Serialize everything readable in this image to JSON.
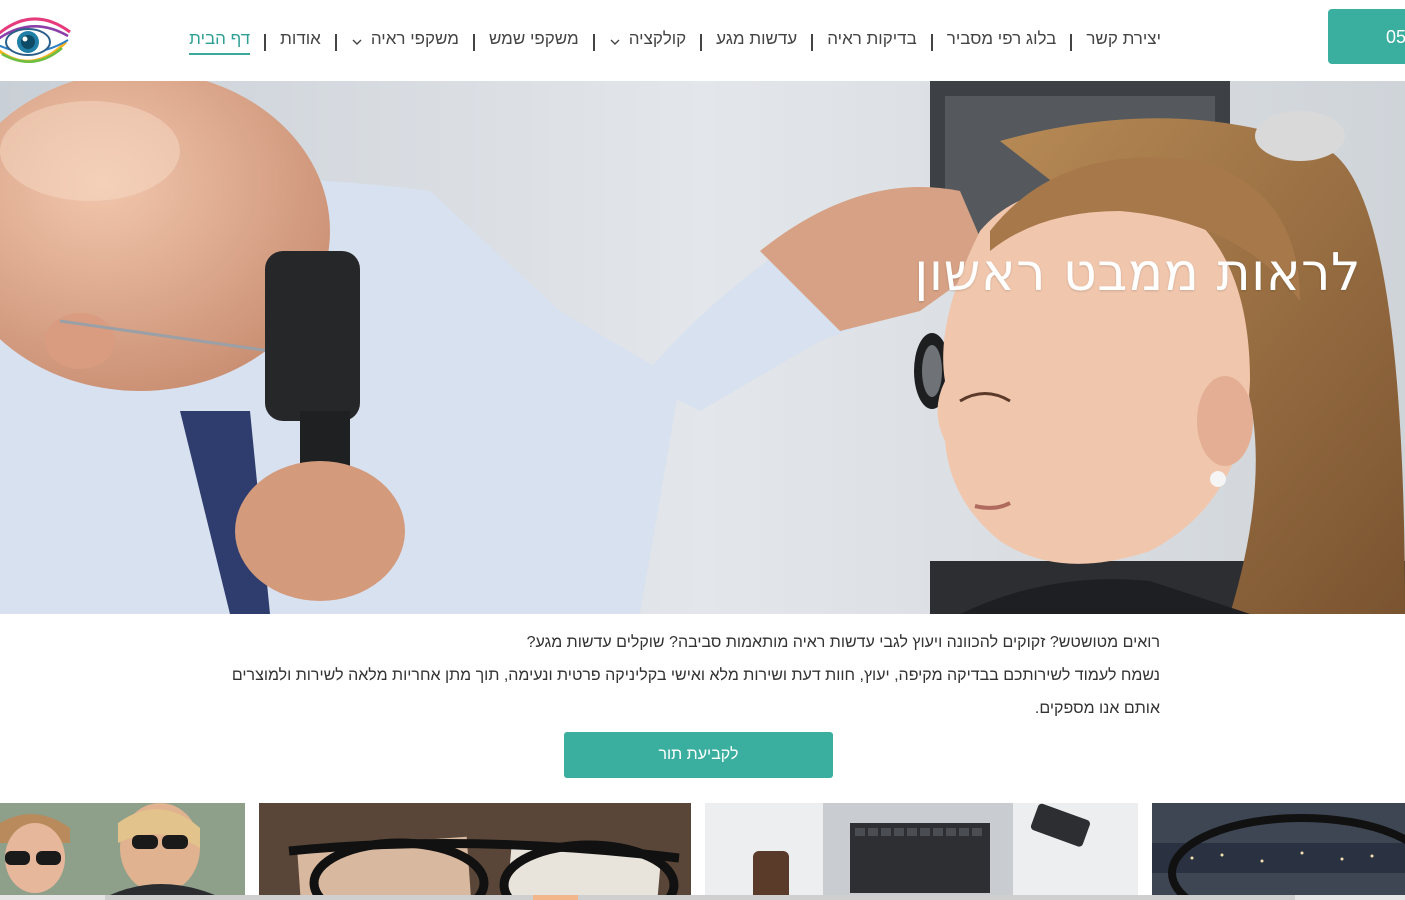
{
  "header": {
    "phone_label": "05",
    "nav": [
      {
        "label": "דף הבית",
        "active": true,
        "dropdown": false
      },
      {
        "label": "אודות",
        "active": false,
        "dropdown": false
      },
      {
        "label": "משקפי ראיה",
        "active": false,
        "dropdown": true
      },
      {
        "label": "משקפי שמש",
        "active": false,
        "dropdown": false
      },
      {
        "label": "קולקציה",
        "active": false,
        "dropdown": true
      },
      {
        "label": "עדשות מגע",
        "active": false,
        "dropdown": false
      },
      {
        "label": "בדיקות ראיה",
        "active": false,
        "dropdown": false
      },
      {
        "label": "בלוג רפי מסביר",
        "active": false,
        "dropdown": false
      },
      {
        "label": "יצירת קשר",
        "active": false,
        "dropdown": false
      }
    ]
  },
  "hero": {
    "title": "לראות ממבט ראשון"
  },
  "intro": {
    "line1": "רואים מטושטש? זקוקים להכוונה ויעוץ לגבי עדשות ראיה מותאמות סביבה? שוקלים עדשות מגע?",
    "line2": "נשמח לעמוד לשירותכם בבדיקה מקיפה, יעוץ, חוות דעת ושירות מלא ואישי בקליניקה פרטית ונעימה, תוך מתן אחריות מלאה לשירות ולמוצרים אותם אנו מספקים."
  },
  "cta": {
    "label": "לקביעת תור"
  },
  "colors": {
    "accent": "#3aaf9f",
    "active_nav": "#2e9f92",
    "text": "#333333"
  },
  "gallery": {
    "cards": [
      {
        "icon": "women-sunglasses-photo"
      },
      {
        "icon": "glasses-on-brochures-photo"
      },
      {
        "icon": "laptop-phone-desk-photo"
      },
      {
        "icon": "glasses-city-view-photo"
      }
    ]
  }
}
